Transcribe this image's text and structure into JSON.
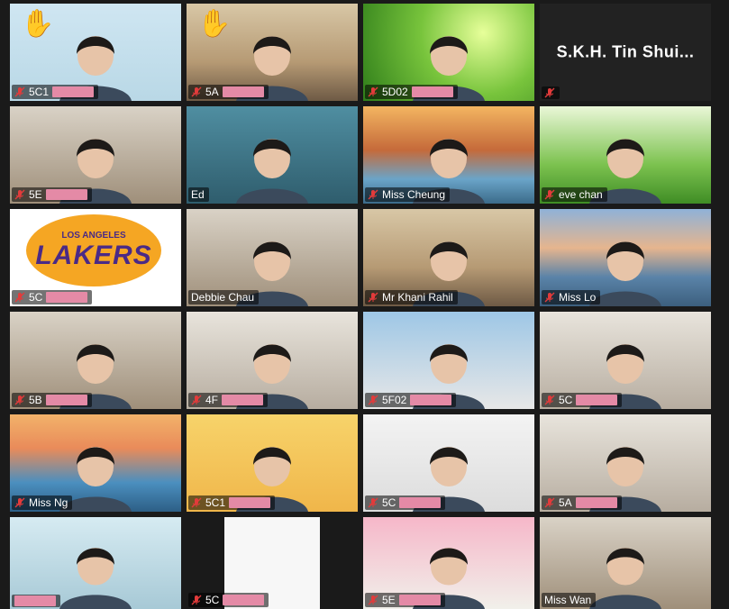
{
  "window": {
    "view": "gallery",
    "background": "#1a1a1a"
  },
  "colors": {
    "active_speaker_border": "#c9d24a",
    "redaction": "#e48aa6",
    "mute_icon": "#e23b3b"
  },
  "tiles": [
    {
      "label": "5C1",
      "muted": true,
      "raised_hand": true,
      "redacted": true,
      "scene": "light-blue wall"
    },
    {
      "label": "5A",
      "muted": true,
      "raised_hand": true,
      "redacted": true,
      "scene": "classroom ceiling"
    },
    {
      "label": "5D02",
      "muted": true,
      "raised_hand": false,
      "redacted": true,
      "scene": "green bubbles"
    },
    {
      "label": "",
      "muted": true,
      "raised_hand": false,
      "redacted": false,
      "scene": "camera off",
      "display_name": "S.K.H. Tin Shui..."
    },
    {
      "label": "5E",
      "muted": true,
      "raised_hand": false,
      "redacted": true,
      "scene": "home"
    },
    {
      "label": "Ed",
      "muted": false,
      "raised_hand": false,
      "redacted": false,
      "scene": "office",
      "active": true
    },
    {
      "label": "Miss Cheung",
      "muted": true,
      "raised_hand": false,
      "redacted": false,
      "scene": "golden gate bridge"
    },
    {
      "label": "eve chan",
      "muted": true,
      "raised_hand": false,
      "redacted": false,
      "scene": "grass"
    },
    {
      "label": "5C",
      "muted": true,
      "raised_hand": false,
      "redacted": true,
      "scene": "lakers logo",
      "logo_text": "LAKERS",
      "logo_sub": "LOS ANGELES"
    },
    {
      "label": "Debbie Chau",
      "muted": false,
      "raised_hand": false,
      "redacted": false,
      "scene": "home"
    },
    {
      "label": "Mr Khani Rahil",
      "muted": true,
      "raised_hand": false,
      "redacted": false,
      "scene": "classroom ceiling"
    },
    {
      "label": "Miss Lo",
      "muted": true,
      "raised_hand": false,
      "redacted": false,
      "scene": "sunset beach"
    },
    {
      "label": "5B",
      "muted": true,
      "raised_hand": false,
      "redacted": true,
      "scene": "home"
    },
    {
      "label": "4F",
      "muted": true,
      "raised_hand": false,
      "redacted": true,
      "scene": "room"
    },
    {
      "label": "5F02",
      "muted": true,
      "raised_hand": false,
      "redacted": true,
      "scene": "school building"
    },
    {
      "label": "5C",
      "muted": true,
      "raised_hand": false,
      "redacted": true,
      "scene": "room"
    },
    {
      "label": "Miss Ng",
      "muted": true,
      "raised_hand": false,
      "redacted": false,
      "scene": "sunset"
    },
    {
      "label": "5C1",
      "muted": true,
      "raised_hand": false,
      "redacted": true,
      "scene": "cartoon avatar"
    },
    {
      "label": "5C",
      "muted": true,
      "raised_hand": false,
      "redacted": true,
      "scene": "white wall"
    },
    {
      "label": "5A",
      "muted": true,
      "raised_hand": false,
      "redacted": true,
      "scene": "room"
    },
    {
      "label": "",
      "muted": false,
      "raised_hand": false,
      "redacted": true,
      "scene": "classroom wall"
    },
    {
      "label": "5C",
      "muted": true,
      "raised_hand": false,
      "redacted": true,
      "scene": "white screen"
    },
    {
      "label": "5E",
      "muted": true,
      "raised_hand": false,
      "redacted": true,
      "scene": "cartoon poster"
    },
    {
      "label": "Miss Wan",
      "muted": false,
      "raised_hand": false,
      "redacted": false,
      "scene": "home"
    }
  ]
}
